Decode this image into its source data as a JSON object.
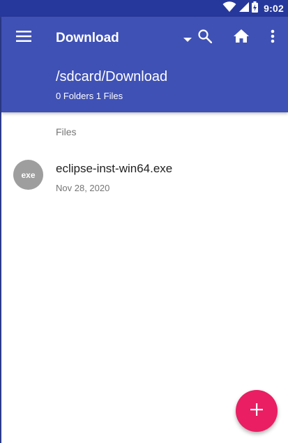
{
  "status_bar": {
    "time": "9:02",
    "icons": [
      "wifi-icon",
      "signal-icon",
      "battery-icon"
    ]
  },
  "app_bar": {
    "title": "Download",
    "path": "/sdcard/Download",
    "counts": "0 Folders 1 Files",
    "actions": [
      "menu-icon",
      "dropdown-arrow-icon",
      "search-icon",
      "home-icon",
      "more-vert-icon"
    ]
  },
  "content": {
    "section_header": "Files",
    "files": [
      {
        "icon_label": "exe",
        "name": "eclipse-inst-win64.exe",
        "date": "Nov 28, 2020"
      }
    ]
  },
  "fab": {
    "icon": "add-icon"
  },
  "colors": {
    "status_bar": "#27389c",
    "app_bar": "#3f51b5",
    "fab": "#e91e63",
    "file_icon_bg": "#9e9e9e"
  }
}
